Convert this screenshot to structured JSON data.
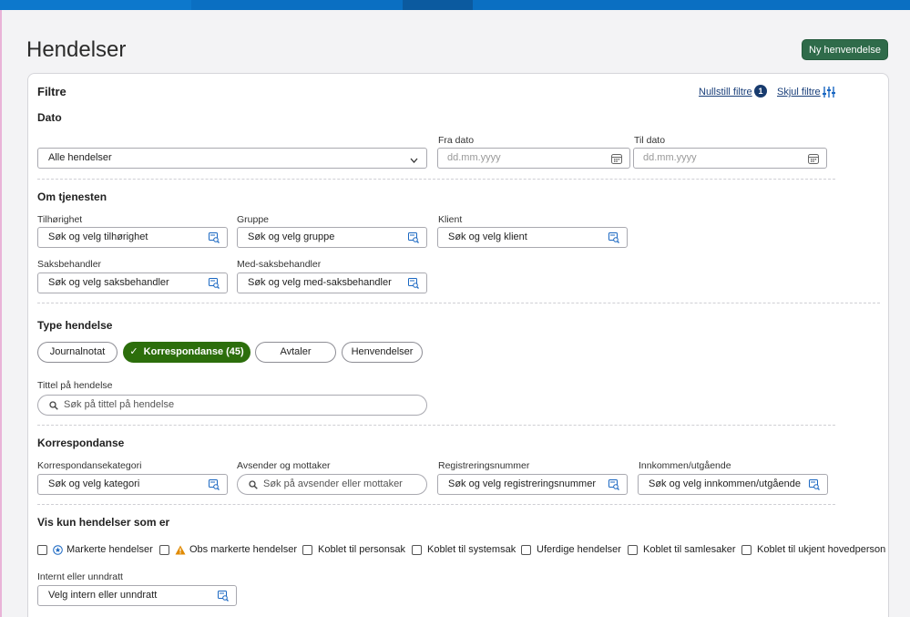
{
  "page": {
    "title": "Hendelser"
  },
  "header": {
    "new_button": "Ny henvendelse"
  },
  "filters": {
    "title": "Filtre",
    "reset_label": "Nullstill filtre",
    "reset_count": "1",
    "hide_label": "Skjul filtre"
  },
  "date": {
    "heading": "Dato",
    "select_value": "Alle hendelser",
    "from_label": "Fra dato",
    "from_placeholder": "dd.mm.yyyy",
    "to_label": "Til dato",
    "to_placeholder": "dd.mm.yyyy"
  },
  "service": {
    "heading": "Om tjenesten",
    "fields": [
      {
        "label": "Tilhørighet",
        "value": "Søk og velg tilhørighet"
      },
      {
        "label": "Gruppe",
        "value": "Søk og velg gruppe"
      },
      {
        "label": "Klient",
        "value": "Søk og velg klient"
      },
      {
        "label": "Saksbehandler",
        "value": "Søk og velg saksbehandler"
      },
      {
        "label": "Med-saksbehandler",
        "value": "Søk og velg med-saksbehandler"
      }
    ]
  },
  "type": {
    "heading": "Type hendelse",
    "chips": [
      {
        "label": "Journalnotat",
        "active": false
      },
      {
        "label": "Korrespondanse (45)",
        "active": true
      },
      {
        "label": "Avtaler",
        "active": false
      },
      {
        "label": "Henvendelser",
        "active": false
      }
    ],
    "title_label": "Tittel på hendelse",
    "title_placeholder": "Søk på tittel på hendelse"
  },
  "correspondence": {
    "heading": "Korrespondanse",
    "fields": [
      {
        "label": "Korrespondansekategori",
        "value": "Søk og velg kategori"
      },
      {
        "label": "Avsender og mottaker",
        "value": "Søk på avsender eller mottaker"
      },
      {
        "label": "Registreringsnummer",
        "value": "Søk og velg registreringsnummer"
      },
      {
        "label": "Innkommen/utgående",
        "value": "Søk og velg innkommen/utgående"
      }
    ]
  },
  "show_only": {
    "heading": "Vis kun hendelser som er",
    "checkboxes": [
      {
        "label": "Markerte hendelser",
        "icon": "star-circle-icon"
      },
      {
        "label": "Obs markerte hendelser",
        "icon": "warning-icon"
      },
      {
        "label": "Koblet til personsak"
      },
      {
        "label": "Koblet til systemsak"
      },
      {
        "label": "Uferdige hendelser"
      },
      {
        "label": "Koblet til samlesaker"
      },
      {
        "label": "Koblet til ukjent hovedperson"
      }
    ],
    "internal_label": "Internt eller unndratt",
    "internal_value": "Velg intern eller unndratt"
  },
  "colors": {
    "primary_green": "#2f6b4a",
    "chip_active": "#2c6e0c",
    "link": "#1a3f7a",
    "brand_blue": "#0a6fc2"
  }
}
